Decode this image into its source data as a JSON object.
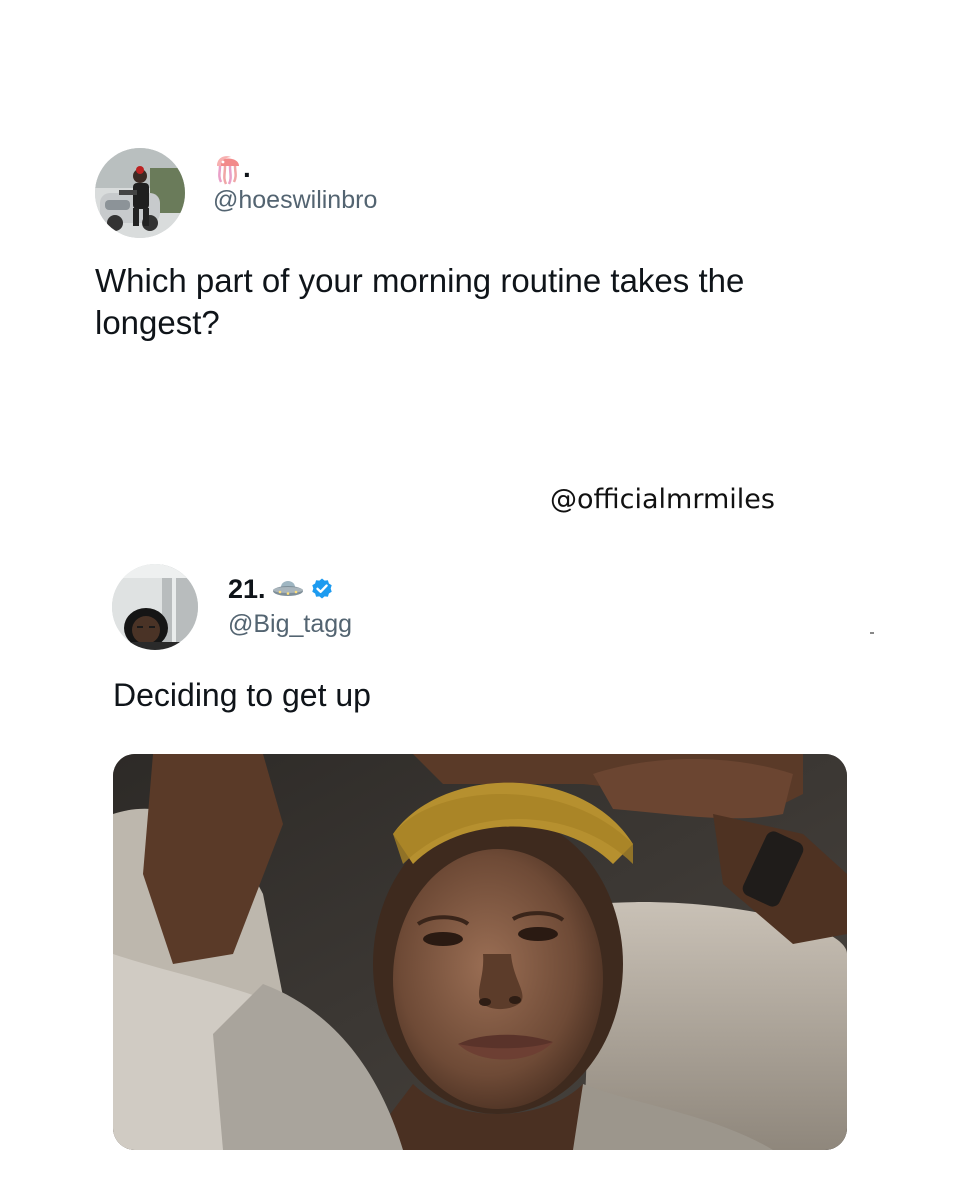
{
  "tweet1": {
    "display_name_suffix": ".",
    "display_name_icon": "jellyfish-icon",
    "handle": "@hoeswilinbro",
    "text": "Which part of your morning routine takes the longest?",
    "avatar_icon": "profile-photo-car"
  },
  "watermark": "@officialmrmiles",
  "tweet2": {
    "display_name": "21.",
    "display_name_icon": "ufo-icon",
    "verified_icon": "verified-badge-icon",
    "handle": "@Big_tagg",
    "text": "Deciding to get up",
    "avatar_icon": "profile-photo-person",
    "media_icon": "photo-woman-lying-in-bed"
  },
  "colors": {
    "text_primary": "#0f1419",
    "text_secondary": "#536471",
    "verified_blue": "#1d9bf0",
    "background": "#ffffff"
  }
}
